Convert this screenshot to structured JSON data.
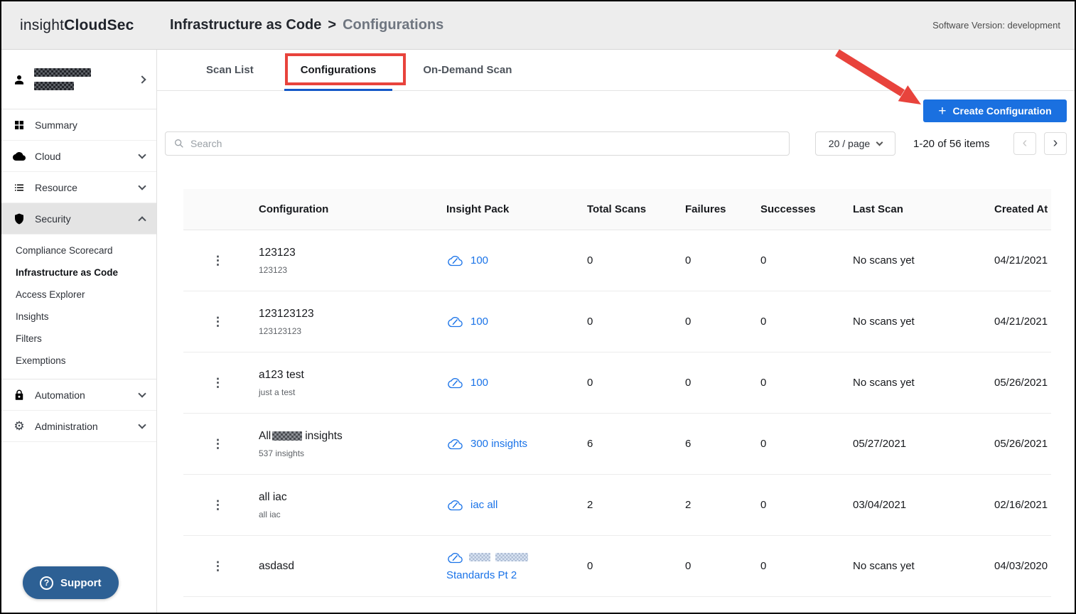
{
  "colors": {
    "accent_blue": "#1a70e0",
    "link_blue": "#1a73e8",
    "annotation_red": "#e8433c",
    "support_blue": "#2d6094",
    "active_tab_underline": "#1458c8"
  },
  "icons": {
    "kebab": "⋮",
    "gear": "⚙",
    "plus": "+",
    "prev": "‹",
    "next": "›",
    "question": "?"
  },
  "header": {
    "brand_light": "insight",
    "brand_bold": "CloudSec",
    "breadcrumb_parent": "Infrastructure as Code",
    "breadcrumb_sep": ">",
    "breadcrumb_current": "Configurations",
    "version": "Software Version: development"
  },
  "sidebar": {
    "user_name_redacted": true,
    "items": [
      {
        "label": "Summary"
      },
      {
        "label": "Cloud"
      },
      {
        "label": "Resource"
      },
      {
        "label": "Security"
      }
    ],
    "security_children": [
      "Compliance Scorecard",
      "Infrastructure as Code",
      "Access Explorer",
      "Insights",
      "Filters",
      "Exemptions"
    ],
    "active_child": "Infrastructure as Code",
    "bottom_items": [
      {
        "label": "Automation"
      },
      {
        "label": "Administration"
      }
    ],
    "support_label": "Support"
  },
  "tabs": [
    {
      "label": "Scan List",
      "active": false
    },
    {
      "label": "Configurations",
      "active": true,
      "annotated": true
    },
    {
      "label": "On-Demand Scan",
      "active": false
    }
  ],
  "toolbar": {
    "create_label": "Create Configuration",
    "search_placeholder": "Search",
    "page_size": "20 / page",
    "range_text": "1-20 of 56 items"
  },
  "table": {
    "columns": [
      "Configuration",
      "Insight Pack",
      "Total Scans",
      "Failures",
      "Successes",
      "Last Scan",
      "Created At"
    ],
    "rows": [
      {
        "name": "123123",
        "description": "123123",
        "pack": "100",
        "total_scans": "0",
        "failures": "0",
        "successes": "0",
        "last_scan": "No scans yet",
        "created_at": "04/21/2021"
      },
      {
        "name": "123123123",
        "description": "123123123",
        "pack": "100",
        "total_scans": "0",
        "failures": "0",
        "successes": "0",
        "last_scan": "No scans yet",
        "created_at": "04/21/2021"
      },
      {
        "name": "a123 test",
        "description": "just a test",
        "pack": "100",
        "total_scans": "0",
        "failures": "0",
        "successes": "0",
        "last_scan": "No scans yet",
        "created_at": "05/26/2021"
      },
      {
        "name_prefix": "All",
        "name_redacted": true,
        "name_suffix": "insights",
        "description": "537 insights",
        "pack": "300 insights",
        "total_scans": "6",
        "failures": "6",
        "successes": "0",
        "last_scan": "05/27/2021",
        "created_at": "05/26/2021"
      },
      {
        "name": "all iac",
        "description": "all iac",
        "pack": "iac all",
        "total_scans": "2",
        "failures": "2",
        "successes": "0",
        "last_scan": "03/04/2021",
        "created_at": "02/16/2021"
      },
      {
        "name": "asdasd",
        "pack_redacted": true,
        "pack_line2": "Standards Pt 2",
        "total_scans": "0",
        "failures": "0",
        "successes": "0",
        "last_scan": "No scans yet",
        "created_at": "04/03/2020"
      }
    ]
  }
}
